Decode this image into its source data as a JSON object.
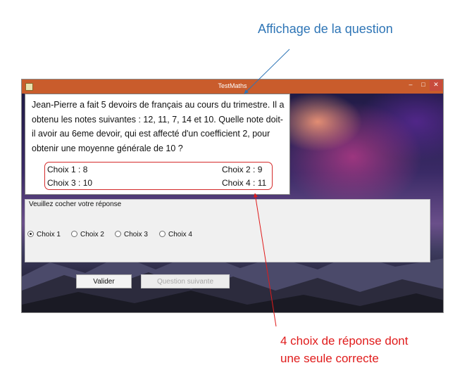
{
  "annotations": {
    "question_display": "Affichage de la question",
    "choices_line1": "4 choix de réponse dont",
    "choices_line2": "une seule correcte"
  },
  "window": {
    "title": "TestMaths",
    "minimize": "–",
    "maximize": "□",
    "close": "✕"
  },
  "question": {
    "text": "Jean-Pierre a fait 5 devoirs de français au cours du trimestre. Il a obtenu les notes suivantes : 12, 11, 7, 14 et 10. Quelle note doit-il avoir au 6eme devoir, qui est affecté d'un coefficient 2, pour obtenir une moyenne générale de 10 ?",
    "choices": [
      "Choix 1 :  8",
      "Choix 2 : 9",
      "Choix 3 : 10",
      "Choix 4 : 11"
    ]
  },
  "answer_group": {
    "legend": "Veuillez cocher votre réponse",
    "options": [
      "Choix 1",
      "Choix 2",
      "Choix 3",
      "Choix 4"
    ],
    "selected": "Choix 1"
  },
  "buttons": {
    "validate": "Valider",
    "next": "Question suivante"
  },
  "colors": {
    "annotation_blue": "#2e75b6",
    "annotation_red": "#e01b1b",
    "titlebar": "#c95c2c"
  }
}
